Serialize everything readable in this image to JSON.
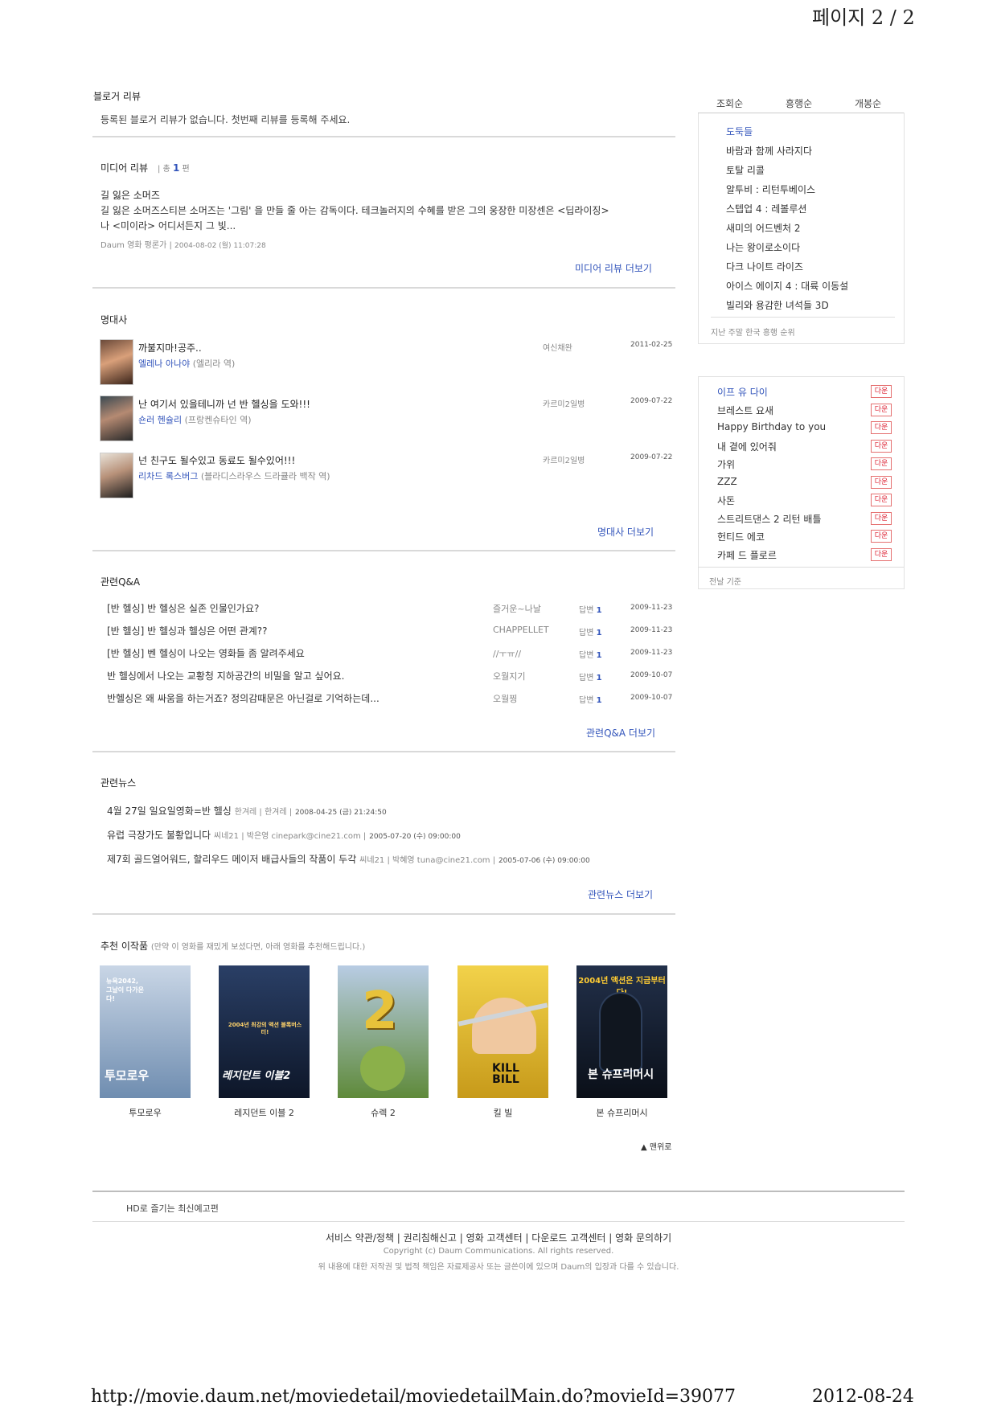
{
  "page_header": "페이지 2 / 2",
  "footer_bar": {
    "url": "http://movie.daum.net/moviedetail/moviedetailMain.do?movieId=39077",
    "date": "2012-08-24"
  },
  "blogger_review": {
    "title": "블로거 리뷰",
    "empty_message": "등록된 블로거 리뷰가 없습니다. 첫번째 리뷰를 등록해 주세요."
  },
  "media_review": {
    "title": "미디어 리뷰",
    "count_prefix": "| 총",
    "count": "1",
    "count_suffix": "편",
    "item": {
      "headline": "길 잃은 소머즈",
      "body_line1": "길 잃은 소머즈스티븐 소머즈는 '그림' 을 만들 줄 아는 감독이다. 테크놀러지의 수혜를 받은 그의 웅장한 미장센은 <딥라이징>",
      "body_line2": "나 <미이라> 어디서든지 그 빛...",
      "meta_source": "Daum 영화 평론가",
      "meta_date": "2004-08-02 (월) 11:07:28"
    },
    "more_link": "미디어 리뷰 더보기"
  },
  "famous_lines": {
    "title": "명대사",
    "items": [
      {
        "quote": "까불지마!공주..",
        "actor": "엘레나 아나야",
        "role": "(엘리라 역)",
        "writer": "여신채완",
        "date": "2011-02-25"
      },
      {
        "quote": "난 여기서 있을테니까 넌 반 헬싱을 도와!!!",
        "actor": "숀러 헨슐리",
        "role": "(프랑켄슈타인 역)",
        "writer": "카르미2일병",
        "date": "2009-07-22"
      },
      {
        "quote": "넌 친구도 될수있고 동료도 될수있어!!!",
        "actor": "리차드 록스버그",
        "role": "(블라디스라우스 드라큘라 백작 역)",
        "writer": "카르미2일병",
        "date": "2009-07-22"
      }
    ],
    "more_link": "명대사 더보기"
  },
  "qa": {
    "title": "관련Q&A",
    "answer_label": "답변",
    "items": [
      {
        "question": "[반 헬싱] 반 헬싱은 실존 인물인가요?",
        "writer": "즐거운~나날",
        "answers": "1",
        "date": "2009-11-23"
      },
      {
        "question": "[반 헬싱] 반 헬싱과 헬싱은 어떤 관계??",
        "writer": "CHAPPELLET",
        "answers": "1",
        "date": "2009-11-23"
      },
      {
        "question": "[반 헬싱] 벤 헬싱이 나오는 영화들 좀 알려주세요",
        "writer": "//ㅜㅠ//",
        "answers": "1",
        "date": "2009-11-23"
      },
      {
        "question": "반 헬싱에서 나오는 교황청 지하공간의 비밀을 알고 싶어요.",
        "writer": "오월지기",
        "answers": "1",
        "date": "2009-10-07"
      },
      {
        "question": "반헬싱은 왜 싸움을 하는거죠? 정의감때문은 아닌걸로 기억하는데...",
        "writer": "오월찡",
        "answers": "1",
        "date": "2009-10-07"
      }
    ],
    "more_link": "관련Q&A 더보기"
  },
  "news": {
    "title": "관련뉴스",
    "items": [
      {
        "headline": "4월 27일 일요일영화=반 헬싱",
        "source": "한겨레 | 한겨레 |",
        "date": "2008-04-25 (금) 21:24:50"
      },
      {
        "headline": "유럽 극장가도 불황입니다",
        "source": "씨네21 | 박은영 cinepark@cine21.com |",
        "date": "2005-07-20 (수) 09:00:00"
      },
      {
        "headline": "제7회 골드얼어워드, 할리우드 메이저 배급사들의 작품이 두각",
        "source": "씨네21 | 박혜영 tuna@cine21.com |",
        "date": "2005-07-06 (수) 09:00:00"
      }
    ],
    "more_link": "관련뉴스 더보기"
  },
  "recommend": {
    "title": "추천 이작품",
    "subtitle": "(만약 이 영화를 재밌게 보셨다면, 아래 영화를 추천해드립니다.)",
    "movies": [
      {
        "title": "투모로우",
        "poster_text": "투모로우",
        "poster_tag": "뉴욕2042, 그날이 다가온다!",
        "colors": [
          "#c9d6e6",
          "#6f8db0"
        ]
      },
      {
        "title": "레지던트 이블 2",
        "poster_text": "레지던트 이블2",
        "poster_tag": "2004년 최강의 액션 블록버스터!",
        "colors": [
          "#2a3f66",
          "#0d1628"
        ]
      },
      {
        "title": "슈렉 2",
        "poster_text": "2",
        "poster_tag": "",
        "colors": [
          "#b8cce4",
          "#5f8a3a"
        ]
      },
      {
        "title": "킬 빌",
        "poster_text": "KILL BILL",
        "poster_tag": "",
        "colors": [
          "#f2d24a",
          "#c79a1a"
        ]
      },
      {
        "title": "본 슈프리머시",
        "poster_text": "본 슈프리머시",
        "poster_tag": "2004년 액션은 지금부터다!",
        "colors": [
          "#22304a",
          "#0a0f18"
        ]
      }
    ]
  },
  "to_top": "▲ 맨위로",
  "footer": {
    "trailer_label": "HD로 즐기는 최신예고편",
    "links": "서비스 약관/정책 | 권리침해신고 | 영화 고객센터 | 다운로드 고객센터 | 영화 문의하기",
    "copyright": "Copyright (c) Daum Communications. All rights reserved.",
    "disclaimer": "위 내용에 대한 저작권 및 법적 책임은 자료제공사 또는 글쓴이에 있으며 Daum의 입장과 다를 수 있습니다."
  },
  "sidebar_rank": {
    "tabs": [
      "조회순",
      "흥행순",
      "개봉순"
    ],
    "items": [
      "도둑들",
      "바람과 함께 사라지다",
      "토탈 리콜",
      "알투비 : 리턴투베이스",
      "스텝업 4 : 레볼루션",
      "새미의 어드벤처 2",
      "나는 왕이로소이다",
      "다크 나이트 라이즈",
      "아이스 에이지 4 : 대륙 이동설",
      "빌리와 용감한 녀석들 3D"
    ],
    "note": "지난 주말 한국 흥행 순위"
  },
  "sidebar_download": {
    "items": [
      "이프 유 다이",
      "브레스트 요새",
      "Happy Birthday to you",
      "내 곁에 있어줘",
      "가위",
      "ZZZ",
      "사돈",
      "스트리트댄스 2 리턴 배틀",
      "헌티드 에코",
      "카페 드 플로르"
    ],
    "badge": "다운",
    "note": "전날 기준"
  },
  "colors": {
    "link": "#3355bb",
    "badge_border": "#e57070",
    "badge_text": "#dd2233"
  }
}
